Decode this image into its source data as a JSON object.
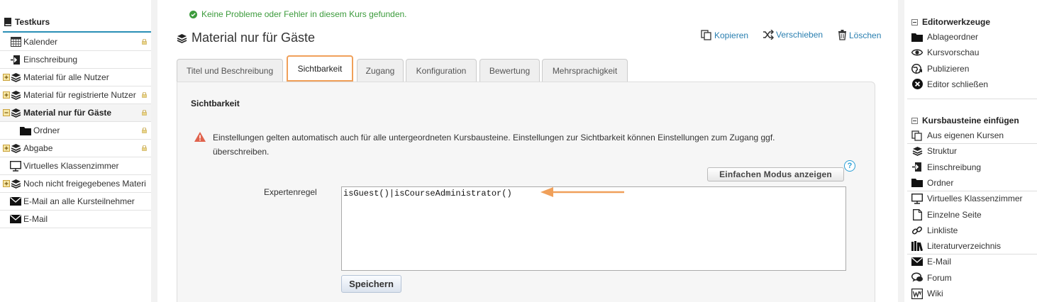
{
  "tree": {
    "root": "Testkurs",
    "items": [
      {
        "label": "Kalender",
        "icon": "calendar-icon",
        "toggle": "none",
        "locked": true,
        "indent": 0
      },
      {
        "label": "Einschreibung",
        "icon": "enrollment-icon",
        "toggle": "none",
        "locked": false,
        "indent": 0
      },
      {
        "label": "Material für alle Nutzer",
        "icon": "layers-icon",
        "toggle": "plus",
        "locked": false,
        "indent": 0
      },
      {
        "label": "Material für registrierte Nutzer",
        "icon": "layers-icon",
        "toggle": "plus",
        "locked": true,
        "indent": 0
      },
      {
        "label": "Material nur für Gäste",
        "icon": "layers-icon",
        "toggle": "minus",
        "locked": true,
        "indent": 0,
        "active": true
      },
      {
        "label": "Ordner",
        "icon": "folder-icon",
        "toggle": "none",
        "locked": true,
        "indent": 1
      },
      {
        "label": "Abgabe",
        "icon": "layers-icon",
        "toggle": "plus",
        "locked": true,
        "indent": 0
      },
      {
        "label": "Virtuelles Klassenzimmer",
        "icon": "monitor-icon",
        "toggle": "none",
        "locked": false,
        "indent": 0
      },
      {
        "label": "Noch nicht freigegebenes Materi",
        "icon": "layers-icon",
        "toggle": "plus",
        "locked": false,
        "indent": 0
      },
      {
        "label": "E-Mail an alle Kursteilnehmer",
        "icon": "mail-icon",
        "toggle": "none",
        "locked": false,
        "indent": 0
      },
      {
        "label": "E-Mail",
        "icon": "mail-icon",
        "toggle": "none",
        "locked": false,
        "indent": 0
      }
    ]
  },
  "status": {
    "message": "Keine Probleme oder Fehler in diesem Kurs gefunden.",
    "color": "#3c9b3c"
  },
  "page": {
    "title": "Material nur für Gäste"
  },
  "actions": {
    "copy": "Kopieren",
    "move": "Verschieben",
    "delete": "Löschen"
  },
  "tabs": [
    "Titel und Beschreibung",
    "Sichtbarkeit",
    "Zugang",
    "Konfiguration",
    "Bewertung",
    "Mehrsprachigkeit"
  ],
  "selected_tab": "Sichtbarkeit",
  "panel": {
    "heading": "Sichtbarkeit",
    "warning": "Einstellungen gelten automatisch auch für alle untergeordneten Kursbausteine. Einstellungen zur Sichtbarkeit können Einstellungen zum Zugang ggf. überschreiben.",
    "simple_mode_button": "Einfachen Modus anzeigen",
    "help_label": "?",
    "expert_rule_label": "Expertenregel",
    "expert_rule_value": "isGuest()|isCourseAdministrator()",
    "save_button": "Speichern"
  },
  "editor_tools": {
    "heading": "Editorwerkzeuge",
    "items": [
      {
        "label": "Ablageordner",
        "icon": "folder-icon"
      },
      {
        "label": "Kursvorschau",
        "icon": "eye-icon"
      },
      {
        "label": "Publizieren",
        "icon": "publish-icon"
      },
      {
        "label": "Editor schließen",
        "icon": "close-circle-icon"
      }
    ]
  },
  "insert_blocks": {
    "heading": "Kursbausteine einfügen",
    "items": [
      {
        "label": "Aus eigenen Kursen",
        "icon": "copy-icon"
      },
      {
        "label": "Struktur",
        "icon": "layers-icon"
      },
      {
        "label": "Einschreibung",
        "icon": "enrollment-icon"
      },
      {
        "label": "Ordner",
        "icon": "folder-icon"
      },
      {
        "label": "Virtuelles Klassenzimmer",
        "icon": "monitor-icon"
      },
      {
        "label": "Einzelne Seite",
        "icon": "page-icon"
      },
      {
        "label": "Linkliste",
        "icon": "link-icon"
      },
      {
        "label": "Literaturverzeichnis",
        "icon": "books-icon"
      },
      {
        "label": "E-Mail",
        "icon": "mail-icon"
      },
      {
        "label": "Forum",
        "icon": "forum-icon"
      },
      {
        "label": "Wiki",
        "icon": "wiki-icon"
      }
    ]
  },
  "colors": {
    "accent": "#2a8fb6",
    "highlight": "#f0a05a",
    "link": "#2a7fb0"
  }
}
